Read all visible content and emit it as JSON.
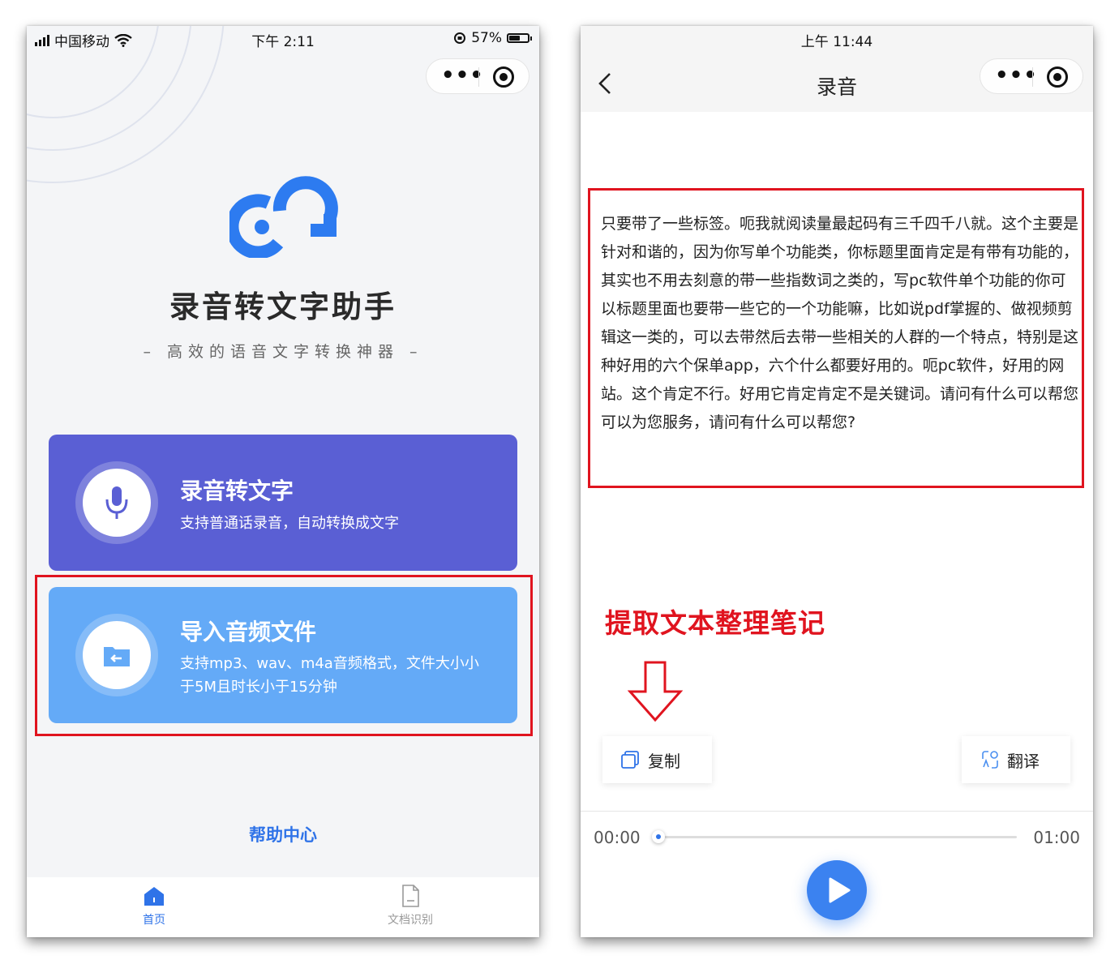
{
  "left": {
    "status": {
      "carrier": "中国移动",
      "time": "下午 2:11",
      "battery": "57%",
      "battery_level": 0.57
    },
    "app_title": "录音转文字助手",
    "subtitle": "– 高效的语音文字转换神器 –",
    "cards": [
      {
        "title": "录音转文字",
        "desc": "支持普通话录音，自动转换成文字",
        "icon": "microphone-icon",
        "color": "#5a5fd4"
      },
      {
        "title": "导入音频文件",
        "desc": "支持mp3、wav、m4a音频格式，文件大小小于5M且时长小于15分钟",
        "icon": "folder-import-icon",
        "color": "#64aaf7"
      }
    ],
    "help_link": "帮助中心",
    "tabs": [
      {
        "label": "首页",
        "icon": "home-icon",
        "active": true
      },
      {
        "label": "文档识别",
        "icon": "document-icon",
        "active": false
      }
    ]
  },
  "right": {
    "status": {
      "time": "上午 11:44"
    },
    "nav_title": "录音",
    "transcript": "只要带了一些标签。呃我就阅读量最起码有三千四千八就。这个主要是针对和谐的，因为你写单个功能类，你标题里面肯定是有带有功能的，其实也不用去刻意的带一些指数词之类的，写pc软件单个功能的你可以标题里面也要带一些它的一个功能嘛，比如说pdf掌握的、做视频剪辑这一类的，可以去带然后去带一些相关的人群的一个特点，特别是这种好用的六个保单app，六个什么都要好用的。呃pc软件，好用的网站。这个肯定不行。好用它肯定肯定不是关键词。请问有什么可以帮您可以为您服务，请问有什么可以帮您?",
    "annotation": "提取文本整理笔记",
    "copy_label": "复制",
    "translate_label": "翻译",
    "time_start": "00:00",
    "time_end": "01:00",
    "progress": 0
  },
  "colors": {
    "accent": "#2f73e8",
    "annotation_red": "#e0141f"
  }
}
